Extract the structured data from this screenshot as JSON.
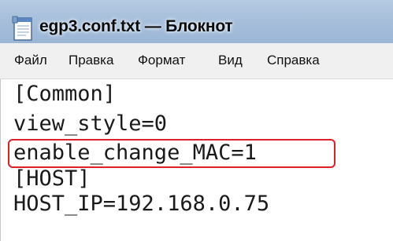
{
  "window": {
    "title": "egp3.conf.txt — Блокнот",
    "icon": "notepad-icon"
  },
  "menu": {
    "items": [
      {
        "label": "Файл"
      },
      {
        "label": "Правка"
      },
      {
        "label": "Формат"
      },
      {
        "label": "Вид"
      },
      {
        "label": "Справка"
      }
    ]
  },
  "editor": {
    "lines": [
      "[Common]",
      "view_style=0",
      "enable_change_MAC=1",
      "[HOST]",
      "HOST_IP=192.168.0.75"
    ],
    "highlighted_line_index": 2,
    "highlight_color": "#e01f26"
  }
}
